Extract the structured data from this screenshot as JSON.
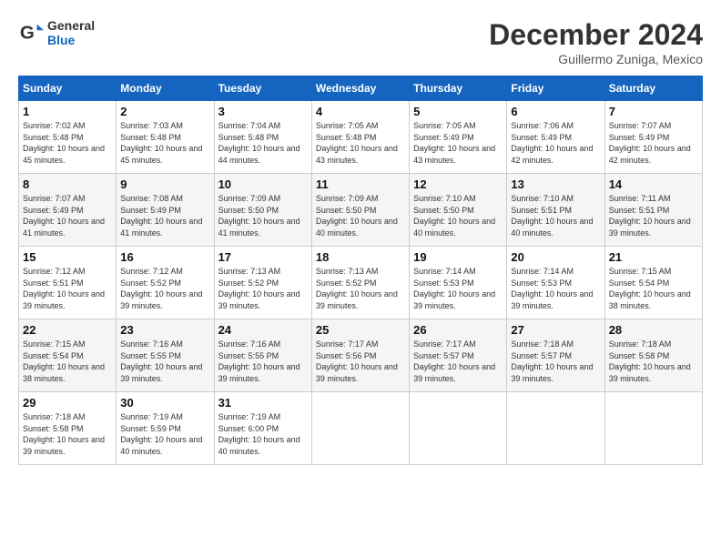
{
  "logo": {
    "line1": "General",
    "line2": "Blue"
  },
  "title": "December 2024",
  "subtitle": "Guillermo Zuniga, Mexico",
  "days_of_week": [
    "Sunday",
    "Monday",
    "Tuesday",
    "Wednesday",
    "Thursday",
    "Friday",
    "Saturday"
  ],
  "weeks": [
    [
      {
        "day": "1",
        "sunrise": "7:02 AM",
        "sunset": "5:48 PM",
        "daylight": "10 hours and 45 minutes."
      },
      {
        "day": "2",
        "sunrise": "7:03 AM",
        "sunset": "5:48 PM",
        "daylight": "10 hours and 45 minutes."
      },
      {
        "day": "3",
        "sunrise": "7:04 AM",
        "sunset": "5:48 PM",
        "daylight": "10 hours and 44 minutes."
      },
      {
        "day": "4",
        "sunrise": "7:05 AM",
        "sunset": "5:48 PM",
        "daylight": "10 hours and 43 minutes."
      },
      {
        "day": "5",
        "sunrise": "7:05 AM",
        "sunset": "5:49 PM",
        "daylight": "10 hours and 43 minutes."
      },
      {
        "day": "6",
        "sunrise": "7:06 AM",
        "sunset": "5:49 PM",
        "daylight": "10 hours and 42 minutes."
      },
      {
        "day": "7",
        "sunrise": "7:07 AM",
        "sunset": "5:49 PM",
        "daylight": "10 hours and 42 minutes."
      }
    ],
    [
      {
        "day": "8",
        "sunrise": "7:07 AM",
        "sunset": "5:49 PM",
        "daylight": "10 hours and 41 minutes."
      },
      {
        "day": "9",
        "sunrise": "7:08 AM",
        "sunset": "5:49 PM",
        "daylight": "10 hours and 41 minutes."
      },
      {
        "day": "10",
        "sunrise": "7:09 AM",
        "sunset": "5:50 PM",
        "daylight": "10 hours and 41 minutes."
      },
      {
        "day": "11",
        "sunrise": "7:09 AM",
        "sunset": "5:50 PM",
        "daylight": "10 hours and 40 minutes."
      },
      {
        "day": "12",
        "sunrise": "7:10 AM",
        "sunset": "5:50 PM",
        "daylight": "10 hours and 40 minutes."
      },
      {
        "day": "13",
        "sunrise": "7:10 AM",
        "sunset": "5:51 PM",
        "daylight": "10 hours and 40 minutes."
      },
      {
        "day": "14",
        "sunrise": "7:11 AM",
        "sunset": "5:51 PM",
        "daylight": "10 hours and 39 minutes."
      }
    ],
    [
      {
        "day": "15",
        "sunrise": "7:12 AM",
        "sunset": "5:51 PM",
        "daylight": "10 hours and 39 minutes."
      },
      {
        "day": "16",
        "sunrise": "7:12 AM",
        "sunset": "5:52 PM",
        "daylight": "10 hours and 39 minutes."
      },
      {
        "day": "17",
        "sunrise": "7:13 AM",
        "sunset": "5:52 PM",
        "daylight": "10 hours and 39 minutes."
      },
      {
        "day": "18",
        "sunrise": "7:13 AM",
        "sunset": "5:52 PM",
        "daylight": "10 hours and 39 minutes."
      },
      {
        "day": "19",
        "sunrise": "7:14 AM",
        "sunset": "5:53 PM",
        "daylight": "10 hours and 39 minutes."
      },
      {
        "day": "20",
        "sunrise": "7:14 AM",
        "sunset": "5:53 PM",
        "daylight": "10 hours and 39 minutes."
      },
      {
        "day": "21",
        "sunrise": "7:15 AM",
        "sunset": "5:54 PM",
        "daylight": "10 hours and 38 minutes."
      }
    ],
    [
      {
        "day": "22",
        "sunrise": "7:15 AM",
        "sunset": "5:54 PM",
        "daylight": "10 hours and 38 minutes."
      },
      {
        "day": "23",
        "sunrise": "7:16 AM",
        "sunset": "5:55 PM",
        "daylight": "10 hours and 39 minutes."
      },
      {
        "day": "24",
        "sunrise": "7:16 AM",
        "sunset": "5:55 PM",
        "daylight": "10 hours and 39 minutes."
      },
      {
        "day": "25",
        "sunrise": "7:17 AM",
        "sunset": "5:56 PM",
        "daylight": "10 hours and 39 minutes."
      },
      {
        "day": "26",
        "sunrise": "7:17 AM",
        "sunset": "5:57 PM",
        "daylight": "10 hours and 39 minutes."
      },
      {
        "day": "27",
        "sunrise": "7:18 AM",
        "sunset": "5:57 PM",
        "daylight": "10 hours and 39 minutes."
      },
      {
        "day": "28",
        "sunrise": "7:18 AM",
        "sunset": "5:58 PM",
        "daylight": "10 hours and 39 minutes."
      }
    ],
    [
      {
        "day": "29",
        "sunrise": "7:18 AM",
        "sunset": "5:58 PM",
        "daylight": "10 hours and 39 minutes."
      },
      {
        "day": "30",
        "sunrise": "7:19 AM",
        "sunset": "5:59 PM",
        "daylight": "10 hours and 40 minutes."
      },
      {
        "day": "31",
        "sunrise": "7:19 AM",
        "sunset": "6:00 PM",
        "daylight": "10 hours and 40 minutes."
      },
      null,
      null,
      null,
      null
    ]
  ]
}
